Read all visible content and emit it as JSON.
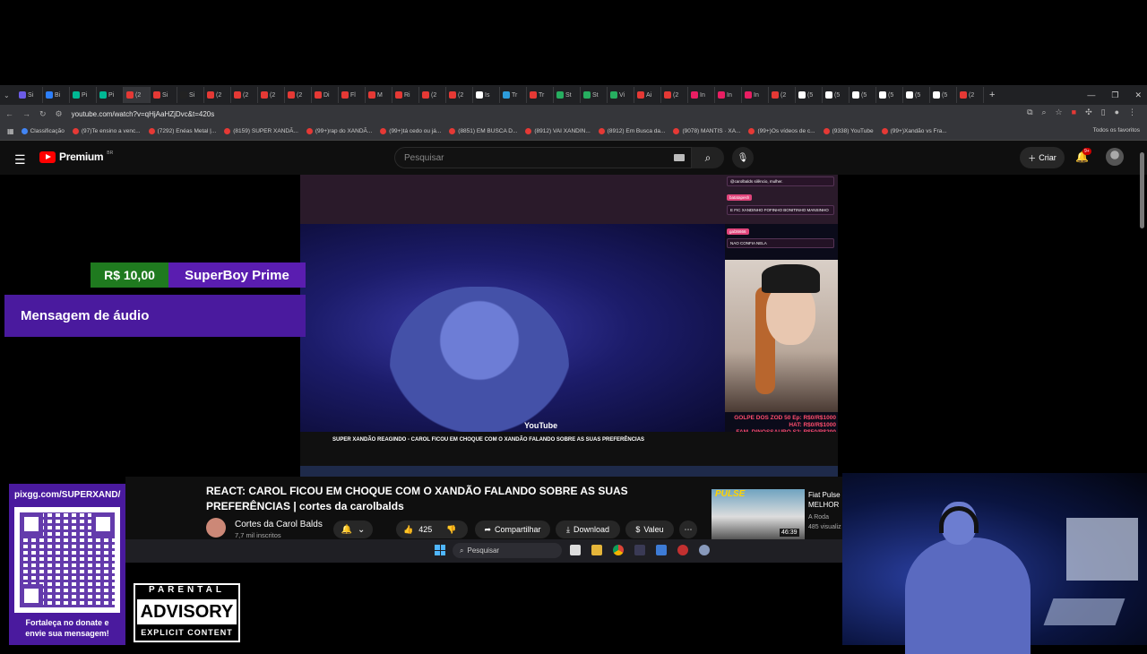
{
  "browser": {
    "tabs": [
      "Si",
      "Bi",
      "Pi",
      "Pi",
      "(2",
      "Si",
      "Si",
      "(2",
      "(2",
      "(2",
      "(2",
      "Di",
      "Fl",
      "M",
      "Ri",
      "(2",
      "(2",
      "Is",
      "Tr",
      "Tr",
      "St",
      "St",
      "Vi",
      "Ai",
      "(2",
      "In",
      "In",
      "In",
      "(2",
      "(5",
      "(5",
      "(5",
      "(5",
      "(5",
      "(5",
      "(2"
    ],
    "url": "youtube.com/watch?v=qHjAaHZjDvc&t=420s",
    "bookmarks": [
      "Classificação",
      "(97)Te ensino a venc...",
      "(7292) Enéas Metal |...",
      "(8159) SUPER XANDÃ...",
      "(99+)rap do XANDÃ...",
      "(99+)tá cedo ou já...",
      "(8851) EM BUSCA D...",
      "(8912) VAI XANDIN...",
      "(8912) Em Busca da...",
      "(9078) MANTIS · XA...",
      "(99+)Os vídeos de c...",
      "(9338) YouTube",
      "(99+)Xandão vs Fra..."
    ],
    "bookmarks_right": "Todos os favoritos"
  },
  "youtube": {
    "logo_text": "Premium",
    "logo_country": "BR",
    "search_placeholder": "Pesquisar",
    "create_label": "Criar",
    "notif_badge": "9+",
    "video_title": "REACT: CAROL FICOU EM CHOQUE COM O XANDÃO FALANDO SOBRE AS SUAS PREFERÊNCIAS | cortes da carolbalds",
    "channel_name": "Cortes da Carol Balds",
    "channel_subs": "7,7 mil inscritos",
    "likes": "425",
    "share_label": "Compartilhar",
    "download_label": "Download",
    "thanks_label": "Valeu",
    "ad": {
      "thumb_label": "PULSE",
      "duration": "46:39",
      "title": "Fiat Pulse MELHOR",
      "channel": "A Roda",
      "views": "485 visualiz"
    }
  },
  "nested_video": {
    "title": "SUPER XANDÃO REAGINDO - CAROL FICOU EM CHOQUE COM O XANDÃO FALANDO SOBRE AS SUAS PREFERÊNCIAS",
    "watermark": "YouTube",
    "chat": [
      {
        "name": "",
        "text": "@carolbalds silêncio, mulher."
      },
      {
        "name": "batatapesh",
        "text": "E FIC XANDINHO FOFINHO BONITINHO MANSINHO"
      },
      {
        "name": "gal36666",
        "text": "NAO CONFIA NELA"
      }
    ],
    "goals": [
      "GOLPE DOS ZOD 50 Ep: R$0/R$1000",
      "HAT: R$0/R$1000",
      "FAM. DINOSSAURO S2: R$50/R$200"
    ]
  },
  "donation": {
    "amount": "R$ 10,00",
    "user": "SuperBoy Prime",
    "message": "Mensagem de áudio"
  },
  "pix": {
    "url": "pixgg.com/SUPERXAND/",
    "message": "Fortaleça no donate e envie sua mensagem!"
  },
  "advisory": {
    "top": "PARENTAL",
    "mid": "ADVISORY",
    "bottom": "EXPLICIT CONTENT"
  },
  "taskbar": {
    "search_placeholder": "Pesquisar"
  },
  "colors": {
    "yt_red": "#ff0000",
    "overlay_purple": "#4a1a9e",
    "donation_green": "#1f7a1f",
    "goal_pink": "#ff4d6d"
  }
}
